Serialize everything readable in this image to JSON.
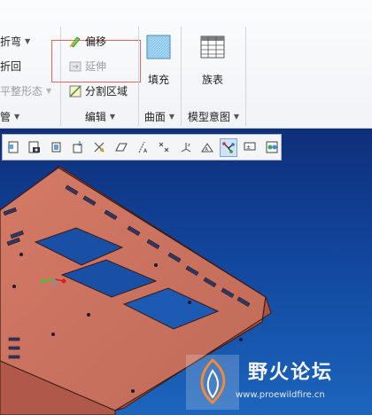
{
  "ribbon": {
    "sheet_group": {
      "items": [
        {
          "label": "折弯",
          "has_dropdown": true,
          "enabled": true
        },
        {
          "label": "折回",
          "has_dropdown": false,
          "enabled": true
        },
        {
          "label": "平整形态",
          "has_dropdown": true,
          "enabled": false
        }
      ],
      "footer": "管"
    },
    "edit_group": {
      "items": [
        {
          "label": "偏移",
          "enabled": true
        },
        {
          "label": "延伸",
          "enabled": false
        },
        {
          "label": "分割区域",
          "enabled": true
        }
      ],
      "footer": "编辑"
    },
    "surface_group": {
      "button": "填充",
      "footer": "曲面"
    },
    "model_intent_group": {
      "button": "族表",
      "footer": "模型意图"
    }
  },
  "viewport": {
    "toolbar_icons": [
      "saved-view-icon",
      "camera-icon",
      "refit-icon",
      "repaint-icon",
      "spin-center-icon",
      "plane-display-icon",
      "axis-display-icon",
      "point-display-icon",
      "csys-display-icon",
      "annotation-display-icon",
      "view-manager-icon",
      "appearance-icon"
    ],
    "active_toolbar_icon": "annotation-display-icon",
    "model_color": "#c9705f"
  },
  "watermark": {
    "name": "野火论坛",
    "url": "www.proewildfire.cn"
  }
}
